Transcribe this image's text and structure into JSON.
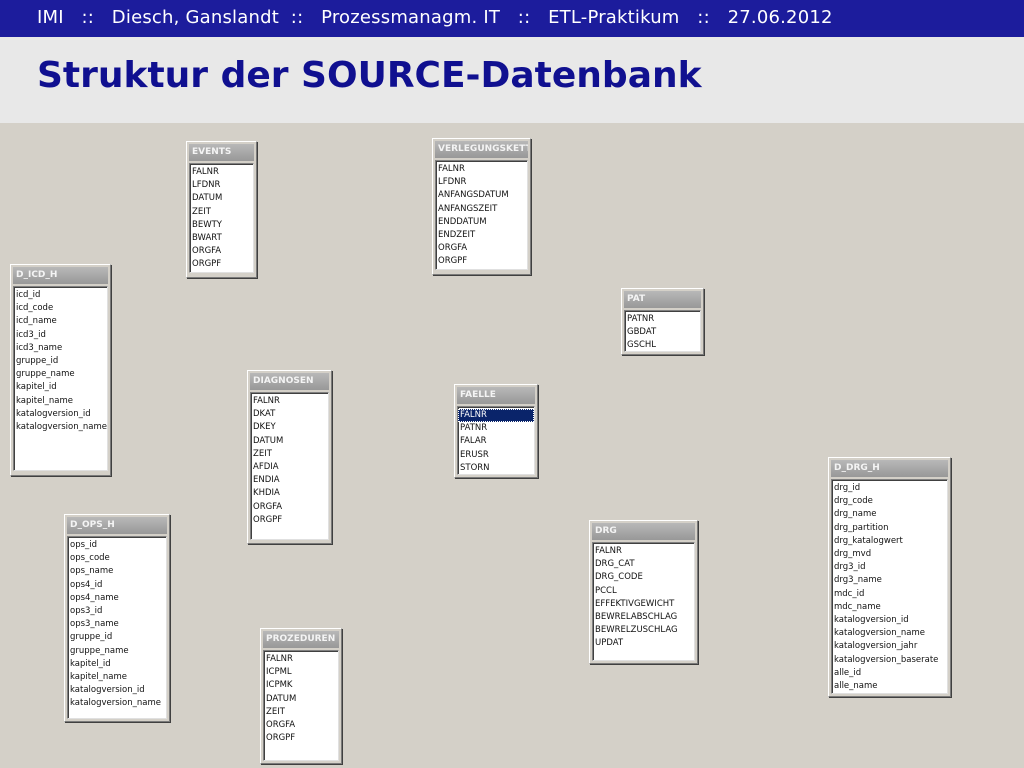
{
  "header": {
    "bar_text": "IMI   ::   Diesch, Ganslandt  ::   Prozessmanagm. IT   ::   ETL-Praktikum   ::   27.06.2012",
    "title": "Struktur der SOURCE-Datenbank"
  },
  "tables": {
    "events": {
      "name": "EVENTS",
      "fields": [
        "FALNR",
        "LFDNR",
        "DATUM",
        "ZEIT",
        "BEWTY",
        "BWART",
        "ORGFA",
        "ORGPF"
      ]
    },
    "verlegungskette": {
      "name": "VERLEGUNGSKETTE",
      "fields": [
        "FALNR",
        "LFDNR",
        "ANFANGSDATUM",
        "ANFANGSZEIT",
        "ENDDATUM",
        "ENDZEIT",
        "ORGFA",
        "ORGPF"
      ]
    },
    "d_icd_h": {
      "name": "D_ICD_H",
      "fields": [
        "icd_id",
        "icd_code",
        "icd_name",
        "icd3_id",
        "icd3_name",
        "gruppe_id",
        "gruppe_name",
        "kapitel_id",
        "kapitel_name",
        "katalogversion_id",
        "katalogversion_name"
      ]
    },
    "pat": {
      "name": "PAT",
      "fields": [
        "PATNR",
        "GBDAT",
        "GSCHL"
      ]
    },
    "diagnosen": {
      "name": "DIAGNOSEN",
      "fields": [
        "FALNR",
        "DKAT",
        "DKEY",
        "DATUM",
        "ZEIT",
        "AFDIA",
        "ENDIA",
        "KHDIA",
        "ORGFA",
        "ORGPF"
      ]
    },
    "faelle": {
      "name": "FAELLE",
      "fields": [
        "FALNR",
        "PATNR",
        "FALAR",
        "ERUSR",
        "STORN"
      ],
      "selected_field": "FALNR"
    },
    "d_drg_h": {
      "name": "D_DRG_H",
      "fields": [
        "drg_id",
        "drg_code",
        "drg_name",
        "drg_partition",
        "drg_katalogwert",
        "drg_mvd",
        "drg3_id",
        "drg3_name",
        "mdc_id",
        "mdc_name",
        "katalogversion_id",
        "katalogversion_name",
        "katalogversion_jahr",
        "katalogversion_baserate",
        "alle_id",
        "alle_name"
      ]
    },
    "d_ops_h": {
      "name": "D_OPS_H",
      "fields": [
        "ops_id",
        "ops_code",
        "ops_name",
        "ops4_id",
        "ops4_name",
        "ops3_id",
        "ops3_name",
        "gruppe_id",
        "gruppe_name",
        "kapitel_id",
        "kapitel_name",
        "katalogversion_id",
        "katalogversion_name"
      ]
    },
    "drg": {
      "name": "DRG",
      "fields": [
        "FALNR",
        "DRG_CAT",
        "DRG_CODE",
        "PCCL",
        "EFFEKTIVGEWICHT",
        "BEWRELABSCHLAG",
        "BEWRELZUSCHLAG",
        "UPDAT"
      ]
    },
    "prozeduren": {
      "name": "PROZEDUREN",
      "fields": [
        "FALNR",
        "ICPML",
        "ICPMK",
        "DATUM",
        "ZEIT",
        "ORGFA",
        "ORGPF"
      ]
    }
  }
}
